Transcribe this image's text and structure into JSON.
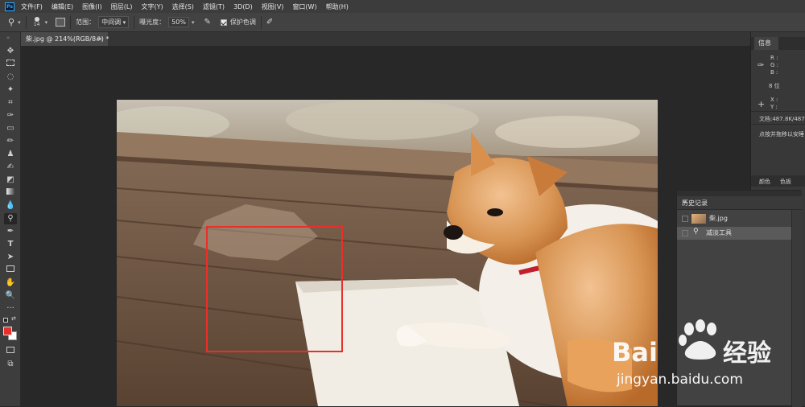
{
  "menu": {
    "logo": "Ps",
    "items": [
      "文件(F)",
      "编辑(E)",
      "图像(I)",
      "图层(L)",
      "文字(Y)",
      "选择(S)",
      "滤镜(T)",
      "3D(D)",
      "视图(V)",
      "窗口(W)",
      "帮助(H)"
    ]
  },
  "options": {
    "brush_size": "14",
    "range_label": "范围：",
    "range_value": "中间调",
    "exposure_label": "曝光度：",
    "exposure_value": "50%",
    "protect_label": "保护色调"
  },
  "document": {
    "tab_title": "柴.jpg @ 214%(RGB/8#) *",
    "close": "×"
  },
  "info_panel": {
    "tab": "信息",
    "r": "R :",
    "g": "G :",
    "b": "B :",
    "bit": "8 位",
    "x": "X :",
    "y": "Y :",
    "doc_size": "文档:487.8K/487.8",
    "hint": "点按并拖移以安睡",
    "color_tab": "颜色",
    "swatch_tab": "色板"
  },
  "history_panel": {
    "title": "历史记录",
    "items": [
      {
        "label": "柴.jpg",
        "kind": "snapshot"
      },
      {
        "label": "减淡工具",
        "kind": "step"
      }
    ]
  },
  "watermark": {
    "brand": "Bai",
    "brand2": "经验",
    "url": "jingyan.baidu.com"
  },
  "colors": {
    "foreground": "#e8302b",
    "background": "#ffffff",
    "selection": "#e8302b",
    "accent": "#31a8ff"
  }
}
